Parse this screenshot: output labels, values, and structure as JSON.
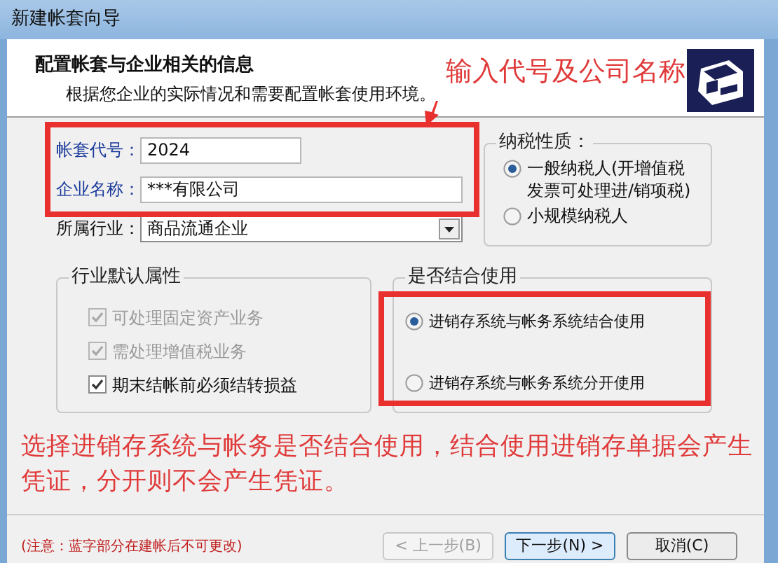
{
  "window": {
    "title": "新建帐套向导"
  },
  "header": {
    "title": "配置帐套与企业相关的信息",
    "subtitle": "根据您企业的实际情况和需要配置帐套使用环境。"
  },
  "fields": [
    {
      "label": "帐套代号：",
      "value": "2024"
    },
    {
      "label": "企业名称：",
      "value": "***有限公司"
    }
  ],
  "industry": {
    "label": "所属行业：",
    "value": "商品流通企业"
  },
  "tax_type": {
    "title": "纳税性质：",
    "options": [
      {
        "lines": [
          "一般纳税人(开增值税",
          "发票可处理进/销项税)"
        ],
        "selected": true
      },
      {
        "lines": [
          "小规模纳税人"
        ],
        "selected": false
      }
    ]
  },
  "industry_defaults": {
    "title": "行业默认属性",
    "options": [
      {
        "label": "可处理固定资产业务",
        "checked": true,
        "disabled": true
      },
      {
        "label": "需处理增值税业务",
        "checked": true,
        "disabled": true
      },
      {
        "label": "期末结帐前必须结转损益",
        "checked": true,
        "disabled": false
      }
    ]
  },
  "integration": {
    "title": "是否结合使用",
    "options": [
      {
        "label": "进销存系统与帐务系统结合使用",
        "selected": true
      },
      {
        "label": "进销存系统与帐务系统分开使用",
        "selected": false
      }
    ]
  },
  "note": "(注意：蓝字部分在建帐后不可更改)",
  "buttons": [
    {
      "label": "< 上一步(B)",
      "disabled": true,
      "default": false
    },
    {
      "label": "下一步(N) >",
      "disabled": false,
      "default": true
    },
    {
      "label": "取消(C)",
      "disabled": false,
      "default": false
    }
  ],
  "annotations": {
    "callout": "输入代号及公司名称",
    "explanation": "选择进销存系统与帐务是否结合使用，结合使用进销存单据会产生凭证，分开则不会产生凭证。"
  }
}
